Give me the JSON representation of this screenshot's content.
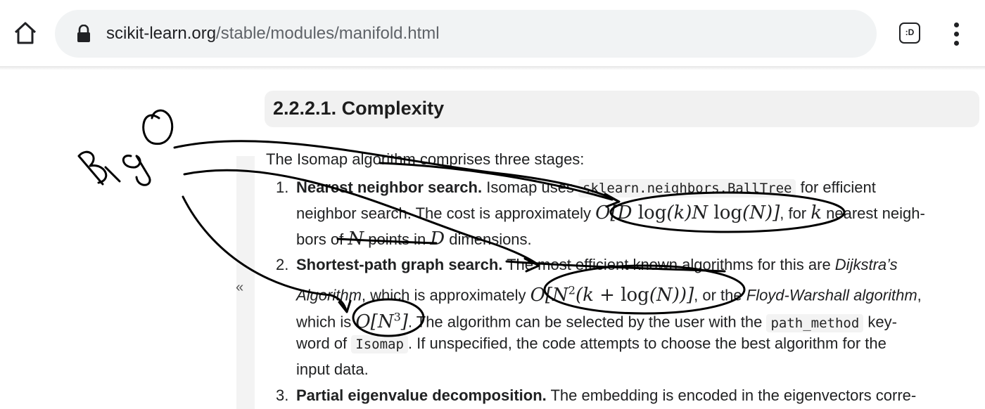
{
  "browser": {
    "url_host": "scikit-learn.org",
    "url_path": "/stable/modules/manifold.html",
    "tab_switcher_label": ":D"
  },
  "page": {
    "section_title": "2.2.2.1. Complexity",
    "collapse_label": "«",
    "intro": "The Isomap algorithm comprises three stages:",
    "items": [
      {
        "number": "1.",
        "title": "Nearest neighbor search.",
        "t1": " Isomap uses ",
        "code": "sklearn.neighbors.BallTree",
        "t2": " for efficient",
        "l2a": "neighbor search. The cost is approximately ",
        "math": "O[D log(k) N log(N)]",
        "l2b": ", for ",
        "k": "k",
        "l2c": " nearest neigh-",
        "l3a": "bors of ",
        "N": "N",
        "l3b": " points in ",
        "D": "D",
        "l3c": " dimensions."
      },
      {
        "number": "2.",
        "title": "Shortest-path graph search.",
        "t1": " The most efficient known algorithms for this are ",
        "dijkstra1": "Dijkstra’s",
        "dijkstra2": "Algorithm",
        "l2a": ", which is approximately ",
        "math": "O[N2(k + log(N))]",
        "l2b": ", or the ",
        "floyd": "Floyd-Warshall algorithm",
        "l2c": ",",
        "l3a": "which is ",
        "math2": "O[N3]",
        "l3b": ". The algorithm can be selected by the user with the ",
        "code1": "path_method",
        "l3c": " key-",
        "l4a": "word of ",
        "code2": "Isomap",
        "l4b": ". If unspecified, the code attempts to choose the best algorithm for the",
        "l5": "input data."
      },
      {
        "number": "3.",
        "title": "Partial eigenvalue decomposition.",
        "t1": " The embedding is encoded in the eigenvectors corre-"
      }
    ]
  },
  "annotation": {
    "text": "Big O",
    "ink_color": "#000000"
  }
}
